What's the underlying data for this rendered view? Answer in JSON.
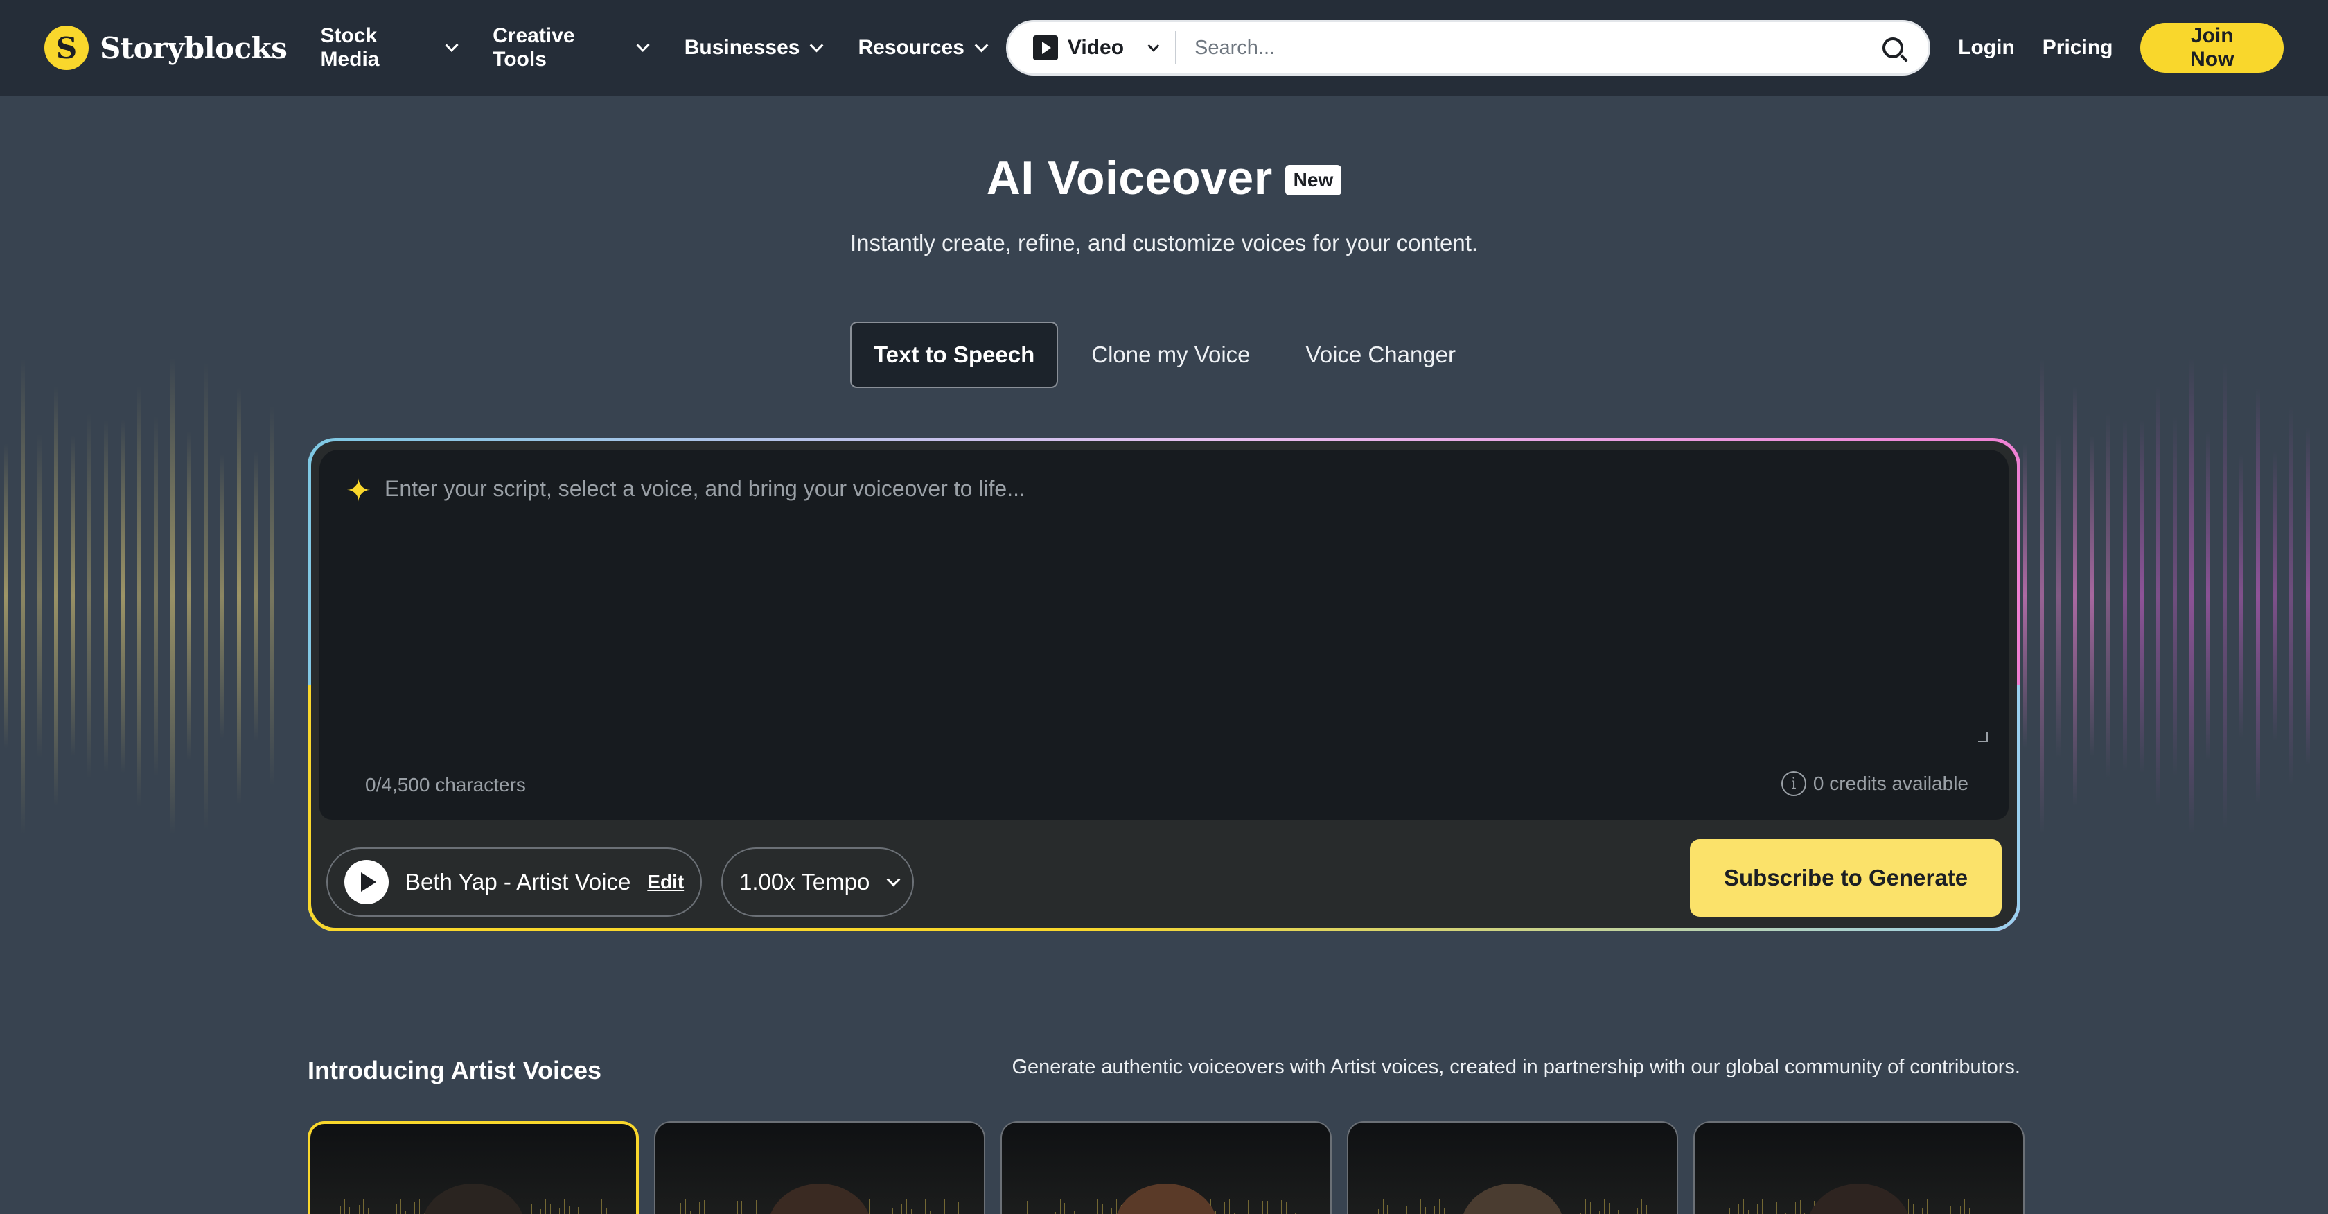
{
  "nav": {
    "logo_mark": "S",
    "logo_text": "Storyblocks",
    "menu": [
      {
        "label": "Stock Media"
      },
      {
        "label": "Creative Tools"
      },
      {
        "label": "Businesses"
      },
      {
        "label": "Resources"
      }
    ],
    "search": {
      "type_label": "Video",
      "placeholder": "Search...",
      "value": ""
    },
    "login_label": "Login",
    "pricing_label": "Pricing",
    "join_label": "Join Now"
  },
  "hero": {
    "title": "AI Voiceover",
    "badge": "New",
    "subtitle": "Instantly create, refine, and customize voices for your content."
  },
  "tabs": [
    {
      "label": "Text to Speech",
      "active": true
    },
    {
      "label": "Clone my Voice",
      "active": false
    },
    {
      "label": "Voice Changer",
      "active": false
    }
  ],
  "editor": {
    "placeholder": "Enter your script, select a voice, and bring your voiceover to life...",
    "value": "",
    "char_count": "0/4,500 characters",
    "credits": "0 credits available",
    "voice_label": "Beth Yap - Artist Voice",
    "edit_label": "Edit",
    "tempo_label": "1.00x Tempo",
    "generate_label": "Subscribe to Generate"
  },
  "artist_voices": {
    "heading": "Introducing Artist Voices",
    "description": "Generate authentic voiceovers with Artist voices, created in partnership with our global community of contributors.",
    "cards": [
      {
        "selected": true
      },
      {
        "selected": false
      },
      {
        "selected": false
      },
      {
        "selected": false
      },
      {
        "selected": false
      }
    ]
  },
  "colors": {
    "accent": "#f9d72c",
    "page_bg": "#384350",
    "nav_bg": "#252d38",
    "editor_bg": "#171b1f"
  },
  "icons": {
    "logo": "storyblocks-logo-icon",
    "search": "search-icon",
    "sparkle": "sparkle-icon",
    "info": "info-icon",
    "play": "play-icon"
  }
}
